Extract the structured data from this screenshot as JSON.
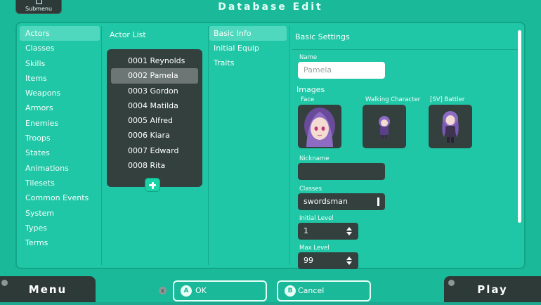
{
  "header": {
    "submenu_label": "Submenu",
    "title": "Database Edit"
  },
  "categories": [
    {
      "label": "Actors",
      "selected": true
    },
    {
      "label": "Classes"
    },
    {
      "label": "Skills"
    },
    {
      "label": "Items"
    },
    {
      "label": "Weapons"
    },
    {
      "label": "Armors"
    },
    {
      "label": "Enemies"
    },
    {
      "label": "Troops"
    },
    {
      "label": "States"
    },
    {
      "label": "Animations"
    },
    {
      "label": "Tilesets"
    },
    {
      "label": "Common Events"
    },
    {
      "label": "System"
    },
    {
      "label": "Types"
    },
    {
      "label": "Terms"
    }
  ],
  "actor_list": {
    "title": "Actor List",
    "items": [
      {
        "label": "0001 Reynolds"
      },
      {
        "label": "0002 Pamela",
        "selected": true
      },
      {
        "label": "0003 Gordon"
      },
      {
        "label": "0004 Matilda"
      },
      {
        "label": "0005 Alfred"
      },
      {
        "label": "0006 Kiara"
      },
      {
        "label": "0007 Edward"
      },
      {
        "label": "0008 Rita"
      }
    ]
  },
  "tabs": [
    {
      "label": "Basic Info",
      "selected": true
    },
    {
      "label": "Initial Equip"
    },
    {
      "label": "Traits"
    }
  ],
  "basic_settings": {
    "title": "Basic Settings",
    "name_label": "Name",
    "name_value": "Pamela",
    "images_title": "Images",
    "face_label": "Face",
    "walking_label": "Walking Character",
    "battler_label": "[SV] Battler",
    "nickname_label": "Nickname",
    "nickname_value": "",
    "classes_label": "Classes",
    "classes_value": "swordsman",
    "initial_level_label": "Initial Level",
    "initial_level_value": "1",
    "max_level_label": "Max Level",
    "max_level_value": "99"
  },
  "footer": {
    "menu_label": "Menu",
    "ok_key": "A",
    "ok_label": "OK",
    "cancel_key": "B",
    "cancel_label": "Cancel",
    "play_label": "Play"
  },
  "colors": {
    "background": "#19b99a",
    "panel": "#20c7a6",
    "dark_box": "#33403e",
    "selection": "#4fd8bd"
  }
}
